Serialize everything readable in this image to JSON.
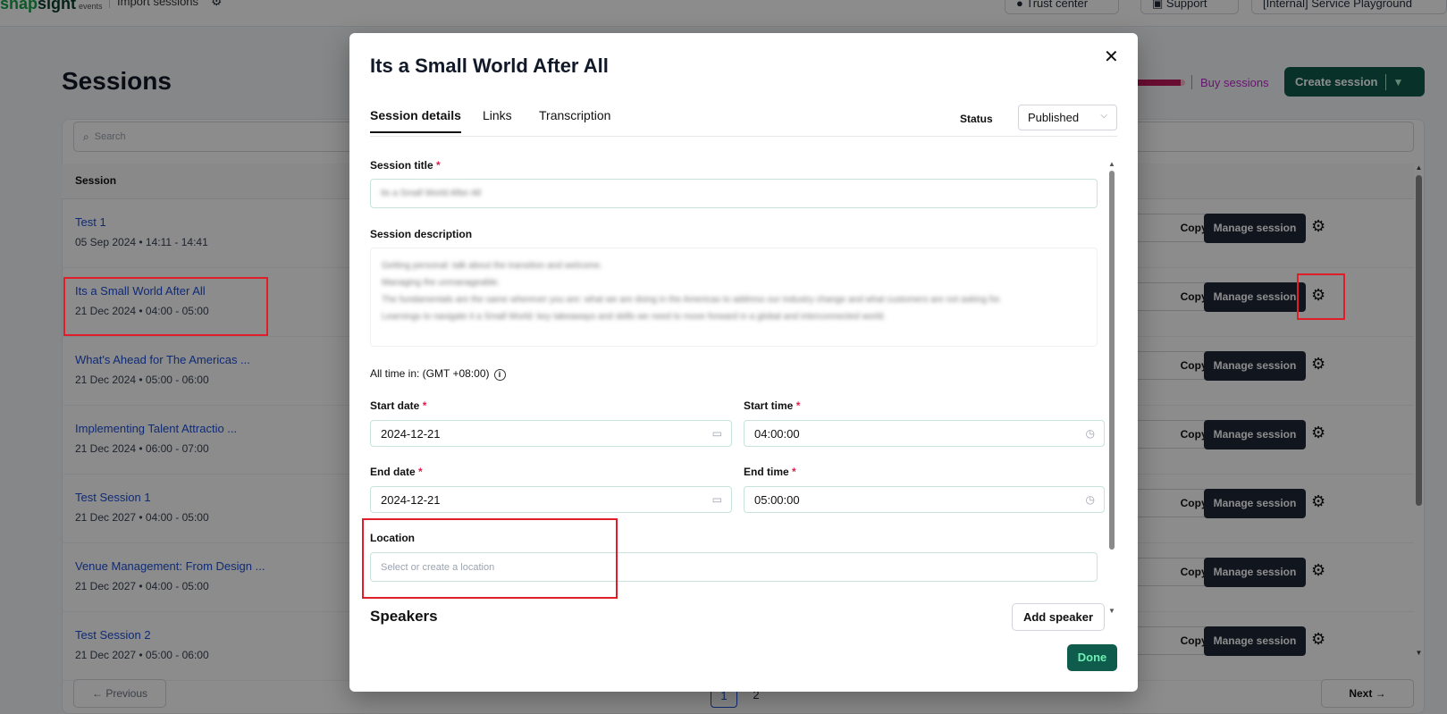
{
  "app": {
    "logo_a": "snap",
    "logo_b": "sight",
    "logo_sub": "events",
    "project": "Import sessions",
    "trust_center": "Trust center",
    "support": "Support",
    "workspace": "[Internal] Service Playground"
  },
  "page": {
    "title": "Sessions",
    "buy_sessions": "Buy sessions",
    "buy_progress_pct": 92,
    "create_session": "Create session",
    "search_placeholder": "Search",
    "column_session": "Session",
    "copy_label": "Copy all links",
    "manage_label": "Manage session",
    "previous": "Previous",
    "next": "Next",
    "pages": [
      "1",
      "2"
    ]
  },
  "sessions": [
    {
      "name": "Test 1",
      "date": "05 Sep 2024 • 14:11 - 14:41"
    },
    {
      "name": "Its a Small World After All",
      "date": "21 Dec 2024 • 04:00 - 05:00"
    },
    {
      "name": "What's Ahead for The Americas ...",
      "date": "21 Dec 2024 • 05:00 - 06:00"
    },
    {
      "name": "Implementing Talent Attractio ...",
      "date": "21 Dec 2024 • 06:00 - 07:00"
    },
    {
      "name": "Test Session 1",
      "date": "21 Dec 2027 • 04:00 - 05:00"
    },
    {
      "name": "Venue Management: From Design ...",
      "date": "21 Dec 2027 • 04:00 - 05:00"
    },
    {
      "name": "Test Session 2",
      "date": "21 Dec 2027 • 05:00 - 06:00"
    }
  ],
  "modal": {
    "title": "Its a Small World After All",
    "close_icon": "close-icon",
    "tabs": [
      "Session details",
      "Links",
      "Transcription"
    ],
    "status_label": "Status",
    "status_value": "Published",
    "session_title_label": "Session title",
    "session_title_value": "Its a Small World After All",
    "description_label": "Session description",
    "description_lines": [
      "Getting personal: talk about the transition and welcome.",
      "Managing the unmanageable.",
      "The fundamentals are the same wherever you are: what we are doing in the Americas to address our industry change and what customers are not asking for.",
      "Learnings to navigate it a Small World: key takeaways and skills we need to move forward in a global and interconnected world."
    ],
    "timezone_text": "All time in: (GMT +08:00)",
    "start_date_label": "Start date",
    "start_date_value": "2024-12-21",
    "start_time_label": "Start time",
    "start_time_value": "04:00:00",
    "end_date_label": "End date",
    "end_date_value": "2024-12-21",
    "end_time_label": "End time",
    "end_time_value": "05:00:00",
    "location_label": "Location",
    "location_placeholder": "Select or create a location",
    "speakers_label": "Speakers",
    "add_speaker": "Add speaker",
    "done": "Done",
    "required_mark": "*"
  },
  "colors": {
    "accent_green": "#0f5c4c",
    "link_blue": "#1d4ed8",
    "highlight_red": "#e11d2a",
    "buy_sessions_magenta": "#c026d3"
  }
}
